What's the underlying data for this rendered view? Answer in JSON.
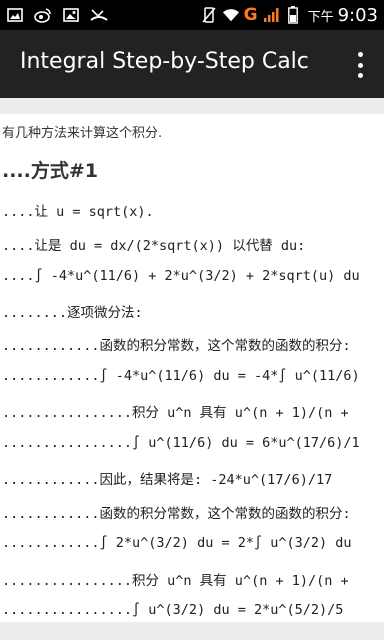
{
  "status_bar": {
    "carrier_mark": "G",
    "time_prefix": "下午",
    "time": "9:03"
  },
  "app": {
    "title": "Integral Step-by-Step Calc"
  },
  "content": {
    "intro": "有几种方法来计算这个积分.",
    "method_heading": "....方式#1",
    "steps": [
      "....让 u = sqrt(x).",
      "....让是 du = dx/(2*sqrt(x)) 以代替 du:",
      "....∫ -4*u^(11/6) + 2*u^(3/2) + 2*sqrt(u) du",
      "........逐项微分法:",
      "............函数的积分常数，这个常数的函数的积分:",
      "............∫ -4*u^(11/6) du = -4*∫ u^(11/6)",
      "................积分 u^n 具有 u^(n + 1)/(n +",
      "................∫ u^(11/6) du = 6*u^(17/6)/1",
      "............因此，结果将是: -24*u^(17/6)/17",
      "............函数的积分常数，这个常数的函数的积分:",
      "............∫ 2*u^(3/2) du = 2*∫ u^(3/2) du",
      "................积分 u^n 具有 u^(n + 1)/(n +",
      "................∫ u^(3/2) du = 2*u^(5/2)/5"
    ]
  }
}
